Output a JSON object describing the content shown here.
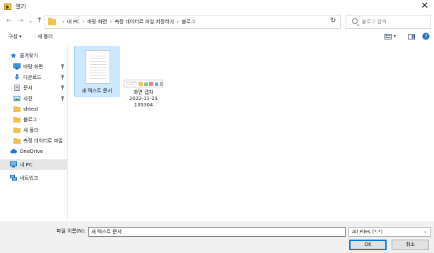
{
  "window": {
    "title": "열기",
    "close_glyph": "✕"
  },
  "navigation": {
    "back_glyph": "←",
    "forward_glyph": "→",
    "recent_glyph": "⌄",
    "up_glyph": "↑",
    "breadcrumbs": [
      "내 PC",
      "바탕 화면",
      "측정 데이터로 파일 저장하기",
      "블로그"
    ],
    "separator": "›",
    "dropdown_glyph": "⌄",
    "refresh_glyph": "↻"
  },
  "search": {
    "placeholder": "블로그 검색"
  },
  "toolbar": {
    "organize_label": "구성 ▾",
    "new_folder_label": "새 폴더",
    "view_dropdown_glyph": "▾"
  },
  "sidebar": {
    "quick_access_label": "즐겨찾기",
    "items": [
      {
        "label": "바탕 화면",
        "icon": "desktop-icon",
        "pinned": true
      },
      {
        "label": "다운로드",
        "icon": "download-icon",
        "pinned": true
      },
      {
        "label": "문서",
        "icon": "document-icon",
        "pinned": true
      },
      {
        "label": "사진",
        "icon": "picture-icon",
        "pinned": true
      },
      {
        "label": "shtest",
        "icon": "folder-icon",
        "pinned": false
      },
      {
        "label": "블로그",
        "icon": "folder-icon",
        "pinned": false
      },
      {
        "label": "새 폴더",
        "icon": "folder-icon",
        "pinned": false
      },
      {
        "label": "측정 데이터로 파일",
        "icon": "folder-icon",
        "pinned": false
      }
    ],
    "onedrive_label": "OneDrive",
    "thispc_label": "내 PC",
    "network_label": "네트워크"
  },
  "files": [
    {
      "name": "새 텍스트 문서",
      "type": "text-document",
      "selected": true
    },
    {
      "name_lines": [
        "화면 캡처",
        "2022-11-21",
        "135304"
      ],
      "type": "image-thumbnail",
      "selected": false
    }
  ],
  "footer": {
    "filename_label": "파일 이름(N):",
    "filename_value": "새 텍스트 문서",
    "filetype_value": "All Files (*.*)",
    "filetype_chevron": "⌄",
    "ok_label": "OK",
    "cancel_label": "취소"
  },
  "colors": {
    "selection_bg": "#cce8ff",
    "selection_border": "#99d1ff",
    "folder": "#f2c14e",
    "accent": "#0078d7"
  }
}
